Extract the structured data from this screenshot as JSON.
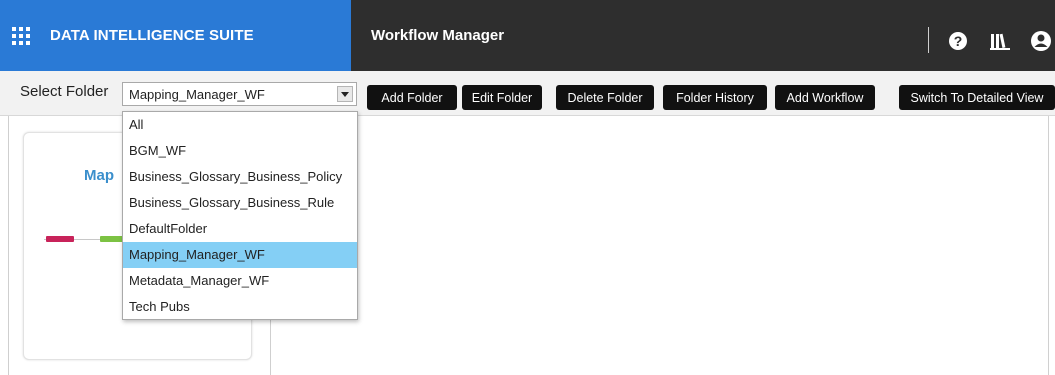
{
  "header": {
    "brand_title": "DATA INTELLIGENCE SUITE",
    "page_title": "Workflow Manager",
    "icons": [
      "apps-grid-icon",
      "help-icon",
      "library-icon",
      "user-icon"
    ]
  },
  "toolbar": {
    "select_label": "Select Folder",
    "selected_folder": "Mapping_Manager_WF",
    "buttons": {
      "add_folder": "Add Folder",
      "edit_folder": "Edit Folder",
      "delete_folder": "Delete Folder",
      "folder_history": "Folder History",
      "add_workflow": "Add Workflow",
      "switch_view": "Switch To Detailed View"
    }
  },
  "dropdown": {
    "options": [
      "All",
      "BGM_WF",
      "Business_Glossary_Business_Policy",
      "Business_Glossary_Business_Rule",
      "DefaultFolder",
      "Mapping_Manager_WF",
      "Metadata_Manager_WF",
      "Tech Pubs"
    ],
    "selected_index": 5
  },
  "workflow_card": {
    "title_visible": "Map"
  },
  "colors": {
    "brand_blue": "#2a7ad6",
    "topbar": "#2e2e2e",
    "button_bg": "#111111",
    "selected_option": "#84cff5",
    "card_title": "#3b8fcc",
    "node_red": "#c8235a",
    "node_green": "#7cc243"
  }
}
